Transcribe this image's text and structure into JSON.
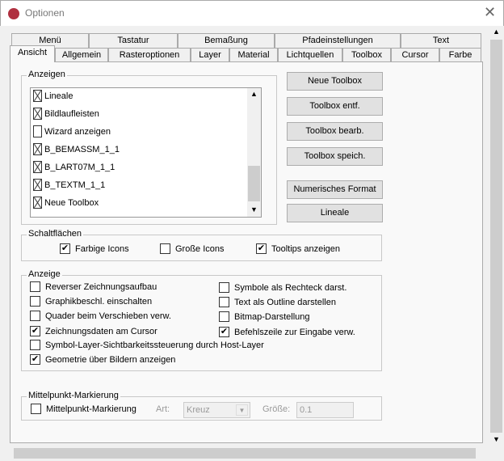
{
  "window": {
    "title": "Optionen",
    "close_icon": "close-icon"
  },
  "tabs_row1": [
    "Menü",
    "Tastatur",
    "Bemaßung",
    "Pfadeinstellungen",
    "Text"
  ],
  "tabs_row2": [
    "Ansicht",
    "Allgemein",
    "Rasteroptionen",
    "Layer",
    "Material",
    "Lichtquellen",
    "Toolbox",
    "Cursor",
    "Farbe"
  ],
  "active_tab": "Ansicht",
  "anzeigen": {
    "label": "Anzeigen",
    "items": [
      {
        "label": "Lineale",
        "checked": true
      },
      {
        "label": "Bildlaufleisten",
        "checked": true
      },
      {
        "label": "Wizard anzeigen",
        "checked": false
      },
      {
        "label": "B_BEMASSM_1_1",
        "checked": true
      },
      {
        "label": "B_LART07M_1_1",
        "checked": true
      },
      {
        "label": "B_TEXTM_1_1",
        "checked": true
      },
      {
        "label": "Neue Toolbox",
        "checked": true
      }
    ]
  },
  "buttons": [
    "Neue Toolbox",
    "Toolbox entf.",
    "Toolbox bearb.",
    "Toolbox speich.",
    "Numerisches Format",
    "Lineale"
  ],
  "schaltflaechen": {
    "label": "Schaltflächen",
    "items": [
      {
        "label": "Farbige Icons",
        "checked": true
      },
      {
        "label": "Große Icons",
        "checked": false
      },
      {
        "label": "Tooltips anzeigen",
        "checked": true
      }
    ]
  },
  "anzeige": {
    "label": "Anzeige",
    "left": [
      {
        "label": "Reverser Zeichnungsaufbau",
        "checked": false
      },
      {
        "label": "Graphikbeschl. einschalten",
        "checked": false
      },
      {
        "label": "Quader beim Verschieben verw.",
        "checked": false
      },
      {
        "label": "Zeichnungsdaten am Cursor",
        "checked": true
      },
      {
        "label": "Symbol-Layer-Sichtbarkeitssteuerung durch Host-Layer",
        "checked": false
      },
      {
        "label": "Geometrie über Bildern anzeigen",
        "checked": true
      }
    ],
    "right": [
      {
        "label": "Symbole als Rechteck darst.",
        "checked": false
      },
      {
        "label": "Text als Outline darstellen",
        "checked": false
      },
      {
        "label": "Bitmap-Darstellung",
        "checked": false
      },
      {
        "label": "Befehlszeile zur Eingabe verw.",
        "checked": true
      }
    ]
  },
  "mittelpunkt": {
    "label": "Mittelpunkt-Markierung",
    "checkbox": "Mittelpunkt-Markierung",
    "checked": false,
    "art_label": "Art:",
    "art_value": "Kreuz",
    "groesse_label": "Größe:",
    "groesse_value": "0.1"
  }
}
